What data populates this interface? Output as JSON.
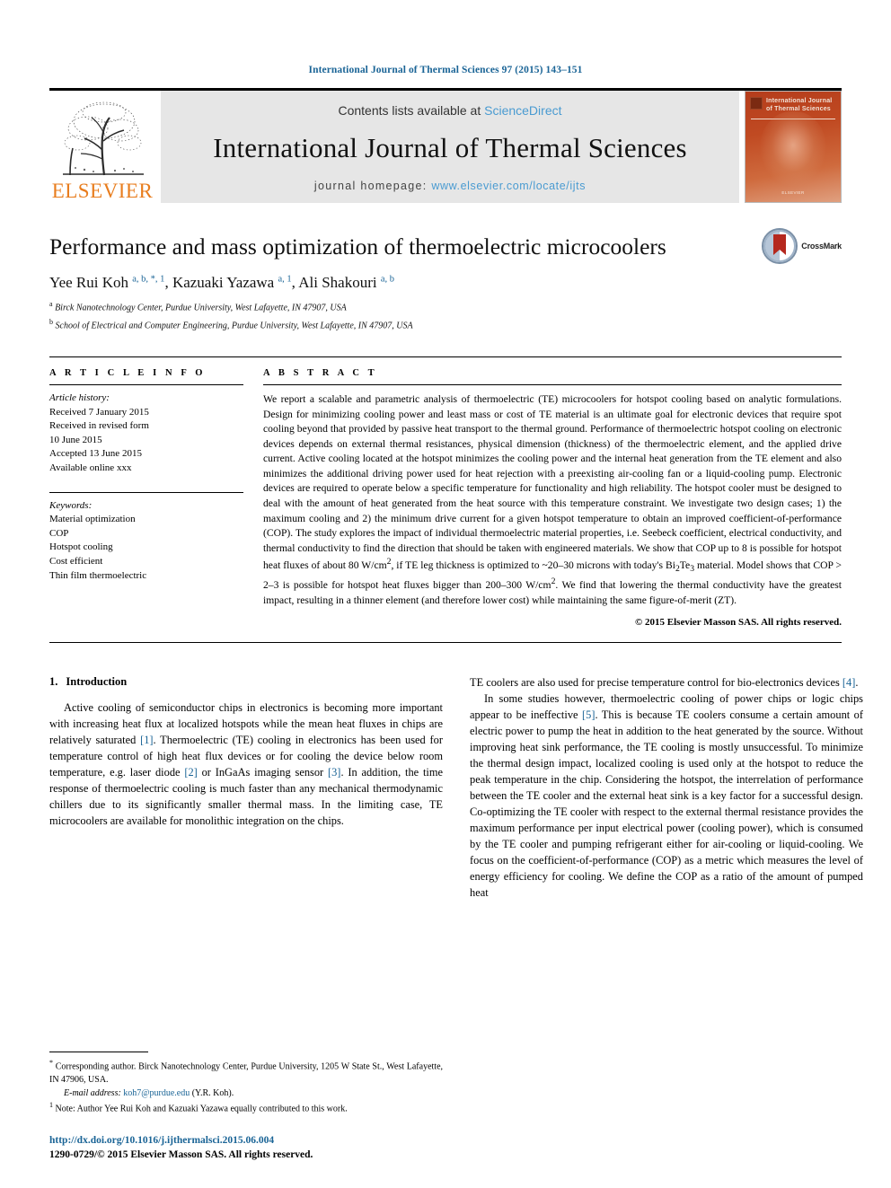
{
  "running_head": "International Journal of Thermal Sciences 97 (2015) 143–151",
  "masthead": {
    "contents_prefix": "Contents lists available at ",
    "sciencedirect": "ScienceDirect",
    "journal_name": "International Journal of Thermal Sciences",
    "homepage_prefix": "journal homepage: ",
    "homepage_url": "www.elsevier.com/locate/ijts",
    "publisher_wordmark": "ELSEVIER",
    "cover_title": "International Journal of Thermal Sciences",
    "accent_link_color": "#4a9bd1",
    "publisher_orange": "#e87d1e"
  },
  "article": {
    "title": "Performance and mass optimization of thermoelectric microcoolers",
    "authors_html": "Yee Rui Koh <sup>a, b, *, 1</sup>, Kazuaki Yazawa <sup>a, 1</sup>, Ali Shakouri <sup>a, b</sup>",
    "affiliation_a": "Birck Nanotechnology Center, Purdue University, West Lafayette, IN 47907, USA",
    "affiliation_b": "School of Electrical and Computer Engineering, Purdue University, West Lafayette, IN 47907, USA",
    "crossmark_label": "CrossMark"
  },
  "article_info": {
    "heading": "A R T I C L E   I N F O",
    "history_label": "Article history:",
    "history": [
      "Received 7 January 2015",
      "Received in revised form",
      "10 June 2015",
      "Accepted 13 June 2015",
      "Available online xxx"
    ],
    "keywords_label": "Keywords:",
    "keywords": [
      "Material optimization",
      "COP",
      "Hotspot cooling",
      "Cost efficient",
      "Thin film thermoelectric"
    ]
  },
  "abstract": {
    "heading": "A B S T R A C T",
    "text": "We report a scalable and parametric analysis of thermoelectric (TE) microcoolers for hotspot cooling based on analytic formulations. Design for minimizing cooling power and least mass or cost of TE material is an ultimate goal for electronic devices that require spot cooling beyond that provided by passive heat transport to the thermal ground. Performance of thermoelectric hotspot cooling on electronic devices depends on external thermal resistances, physical dimension (thickness) of the thermoelectric element, and the applied drive current. Active cooling located at the hotspot minimizes the cooling power and the internal heat generation from the TE element and also minimizes the additional driving power used for heat rejection with a preexisting air-cooling fan or a liquid-cooling pump. Electronic devices are required to operate below a specific temperature for functionality and high reliability. The hotspot cooler must be designed to deal with the amount of heat generated from the heat source with this temperature constraint. We investigate two design cases; 1) the maximum cooling and 2) the minimum drive current for a given hotspot temperature to obtain an improved coefficient-of-performance (COP). The study explores the impact of individual thermoelectric material properties, i.e. Seebeck coefficient, electrical conductivity, and thermal conductivity to find the direction that should be taken with engineered materials. We show that COP up to 8 is possible for hotspot heat fluxes of about 80 W/cm2, if TE leg thickness is optimized to ~20–30 microns with today's Bi2Te3 material. Model shows that COP > 2–3 is possible for hotspot heat fluxes bigger than 200–300 W/cm2. We find that lowering the thermal conductivity have the greatest impact, resulting in a thinner element (and therefore lower cost) while maintaining the same figure-of-merit (ZT).",
    "copyright": "© 2015 Elsevier Masson SAS. All rights reserved."
  },
  "sections": {
    "intro_number": "1.",
    "intro_title": "Introduction",
    "left_p1": "Active cooling of semiconductor chips in electronics is becoming more important with increasing heat flux at localized hotspots while the mean heat fluxes in chips are relatively saturated [1]. Thermoelectric (TE) cooling in electronics has been used for temperature control of high heat flux devices or for cooling the device below room temperature, e.g. laser diode [2] or InGaAs imaging sensor [3]. In addition, the time response of thermoelectric cooling is much faster than any mechanical thermodynamic chillers due to its significantly smaller thermal mass. In the limiting case, TE microcoolers are available for monolithic integration on the chips.",
    "right_p1": "TE coolers are also used for precise temperature control for bio-electronics devices [4].",
    "right_p2": "In some studies however, thermoelectric cooling of power chips or logic chips appear to be ineffective [5]. This is because TE coolers consume a certain amount of electric power to pump the heat in addition to the heat generated by the source. Without improving heat sink performance, the TE cooling is mostly unsuccessful. To minimize the thermal design impact, localized cooling is used only at the hotspot to reduce the peak temperature in the chip. Considering the hotspot, the interrelation of performance between the TE cooler and the external heat sink is a key factor for a successful design. Co-optimizing the TE cooler with respect to the external thermal resistance provides the maximum performance per input electrical power (cooling power), which is consumed by the TE cooler and pumping refrigerant either for air-cooling or liquid-cooling. We focus on the coefficient-of-performance (COP) as a metric which measures the level of energy efficiency for cooling. We define the COP as a ratio of the amount of pumped heat"
  },
  "footnotes": {
    "corresponding": "Corresponding author. Birck Nanotechnology Center, Purdue University, 1205 W State St., West Lafayette, IN 47906, USA.",
    "email_label": "E-mail address:",
    "email": "koh7@purdue.edu",
    "email_suffix": "(Y.R. Koh).",
    "note": "Note: Author Yee Rui Koh and Kazuaki Yazawa equally contributed to this work."
  },
  "footer": {
    "doi": "http://dx.doi.org/10.1016/j.ijthermalsci.2015.06.004",
    "issn_line": "1290-0729/© 2015 Elsevier Masson SAS. All rights reserved."
  }
}
